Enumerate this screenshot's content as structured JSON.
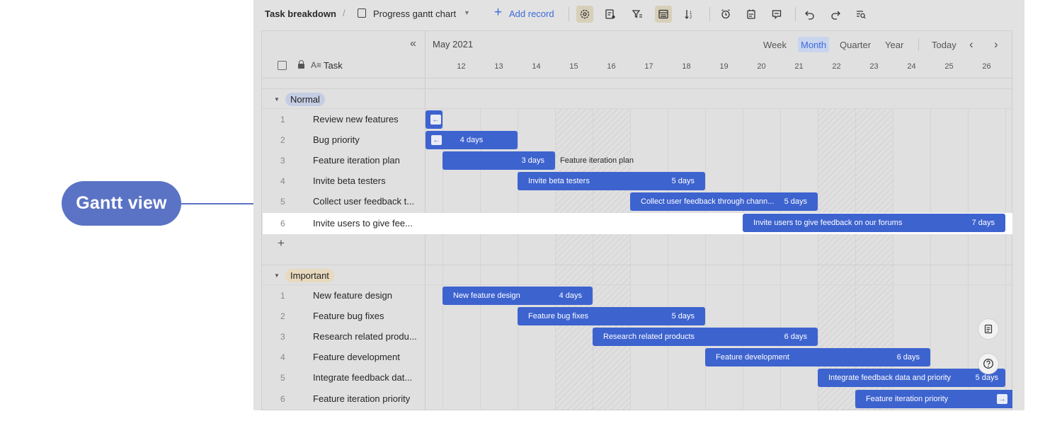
{
  "callout": {
    "label": "Gantt view"
  },
  "toolbar": {
    "title": "Task breakdown",
    "separator": "/",
    "view_name": "Progress gantt chart",
    "view_caret": "▼",
    "add_plus": "+",
    "add_label": "Add record"
  },
  "gantt_header": {
    "collapse_glyph": "«",
    "task_column_label": "Task",
    "field_icon_glyph": "A≡",
    "month": "May 2021",
    "scales": [
      "Week",
      "Month",
      "Quarter",
      "Year"
    ],
    "active_scale": "Month",
    "today_label": "Today",
    "prev_glyph": "‹",
    "next_glyph": "›",
    "days": [
      "12",
      "13",
      "14",
      "15",
      "16",
      "17",
      "18",
      "19",
      "20",
      "21",
      "22",
      "23",
      "24",
      "25",
      "26"
    ]
  },
  "groups": [
    {
      "label": "Normal",
      "color": "#c5cde4",
      "rows": [
        {
          "num": "1",
          "name": "Review new features"
        },
        {
          "num": "2",
          "name": "Bug priority"
        },
        {
          "num": "3",
          "name": "Feature iteration plan"
        },
        {
          "num": "4",
          "name": "Invite beta testers"
        },
        {
          "num": "5",
          "name": "Collect user feedback t..."
        },
        {
          "num": "6",
          "name": "Invite users to give fee..."
        }
      ],
      "add_row_glyph": "+"
    },
    {
      "label": "Important",
      "color": "#e8d9be",
      "rows": [
        {
          "num": "1",
          "name": "New feature design"
        },
        {
          "num": "2",
          "name": "Feature bug fixes"
        },
        {
          "num": "3",
          "name": "Research related produ..."
        },
        {
          "num": "4",
          "name": "Feature development"
        },
        {
          "num": "5",
          "name": "Integrate feedback dat..."
        },
        {
          "num": "6",
          "name": "Feature iteration priority"
        }
      ]
    }
  ],
  "bars": {
    "normal": [
      {
        "label": "",
        "duration": ""
      },
      {
        "label": "",
        "duration": "4 days"
      },
      {
        "label": "",
        "duration": "3 days",
        "outside": "Feature iteration plan"
      },
      {
        "label": "Invite beta testers",
        "duration": "5 days"
      },
      {
        "label": "Collect user feedback through chann...",
        "duration": "5 days"
      },
      {
        "label": "Invite users to give feedback on our forums",
        "duration": "7 days"
      }
    ],
    "important": [
      {
        "label": "New feature design",
        "duration": "4 days"
      },
      {
        "label": "Feature bug fixes",
        "duration": "5 days"
      },
      {
        "label": "Research related products",
        "duration": "6 days"
      },
      {
        "label": "Feature development",
        "duration": "6 days"
      },
      {
        "label": "Integrate feedback data and priority",
        "duration": "5 days"
      },
      {
        "label": "Feature iteration priority",
        "duration": ""
      }
    ]
  },
  "handle_glyphs": {
    "left_arrow": "←",
    "right_arrow": "→"
  },
  "colors": {
    "bar": "#3d63cf",
    "accent": "#3b6bdc",
    "callout": "#5b73c4"
  }
}
